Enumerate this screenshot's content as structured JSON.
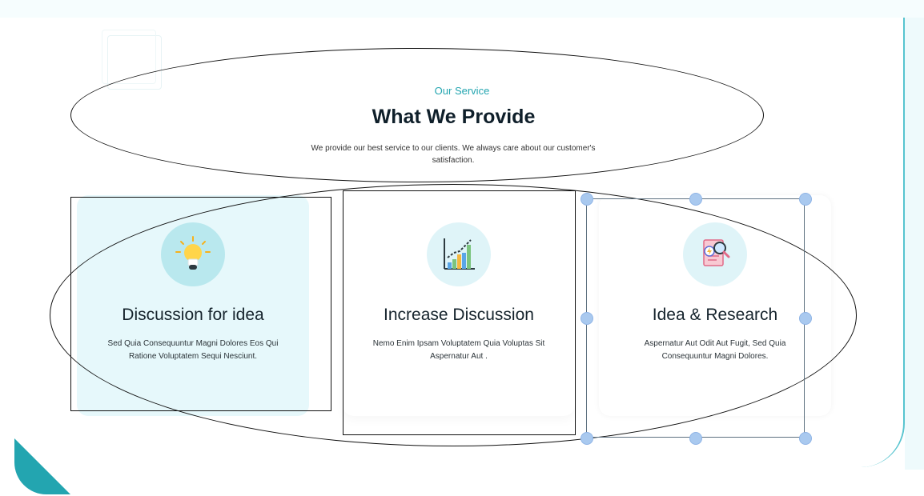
{
  "header": {
    "eyebrow": "Our Service",
    "title": "What We Provide",
    "description": "We provide our best service to our clients. We always care about our customer's satisfaction."
  },
  "cards": [
    {
      "title": "Discussion for idea",
      "text": "Sed Quia Consequuntur Magni Dolores Eos Qui Ratione Voluptatem Sequi Nesciunt.",
      "icon": "lightbulb-icon"
    },
    {
      "title": "Increase Discussion",
      "text": "Nemo Enim Ipsam Voluptatem Quia Voluptas Sit Aspernatur Aut .",
      "icon": "growth-chart-icon"
    },
    {
      "title": "Idea & Research",
      "text": "Aspernatur Aut Odit Aut Fugit, Sed Quia Consequuntur Magni Dolores.",
      "icon": "document-search-icon"
    }
  ],
  "colors": {
    "accent": "#23a5b0",
    "heading": "#0f1f2a",
    "highlight_card": "#e6f8fb",
    "handle": "#a9c9ef"
  }
}
